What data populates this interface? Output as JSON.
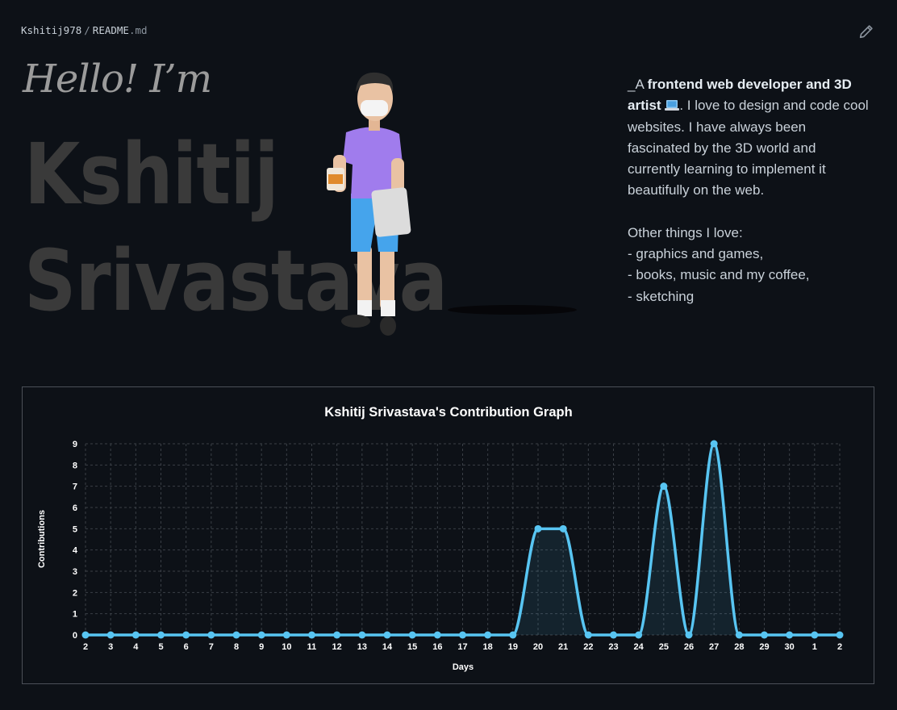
{
  "breadcrumb": {
    "user": "Kshitij978",
    "separator": "/",
    "file": "README",
    "ext": ".md"
  },
  "icons": {
    "edit": "pencil-icon",
    "laptop": "laptop-icon"
  },
  "hero": {
    "hello": "Hello! I’m",
    "first_name": "Kshitij",
    "last_name": "Srivastava"
  },
  "bio": {
    "prefix": "_A ",
    "bold": "frontend web developer and 3D artist",
    "text1": ". I love to design and code cool websites. I have always been fascinated by the 3D world and currently learning to implement it beautifully on the web.",
    "loves_title": "Other things I love:",
    "loves": [
      "- graphics and games,",
      "- books, music and my coffee,",
      "- sketching"
    ]
  },
  "colors": {
    "bg": "#0d1117",
    "line": "#58c5f2",
    "grid": "#3a3f46",
    "text": "#ffffff"
  },
  "chart_data": {
    "type": "line",
    "title": "Kshitij Srivastava's Contribution Graph",
    "xlabel": "Days",
    "ylabel": "Contributions",
    "x": [
      "2",
      "3",
      "4",
      "5",
      "6",
      "7",
      "8",
      "9",
      "10",
      "11",
      "12",
      "13",
      "14",
      "15",
      "16",
      "17",
      "18",
      "19",
      "20",
      "21",
      "22",
      "23",
      "24",
      "25",
      "26",
      "27",
      "28",
      "29",
      "30",
      "1",
      "2"
    ],
    "values": [
      0,
      0,
      0,
      0,
      0,
      0,
      0,
      0,
      0,
      0,
      0,
      0,
      0,
      0,
      0,
      0,
      0,
      0,
      5,
      5,
      0,
      0,
      0,
      7,
      0,
      9,
      0,
      0,
      0,
      0,
      0
    ],
    "ylim": [
      0,
      9
    ],
    "yticks": [
      "0",
      "1",
      "2",
      "3",
      "4",
      "5",
      "6",
      "7",
      "8",
      "9"
    ],
    "grid": true,
    "legend": "none"
  }
}
